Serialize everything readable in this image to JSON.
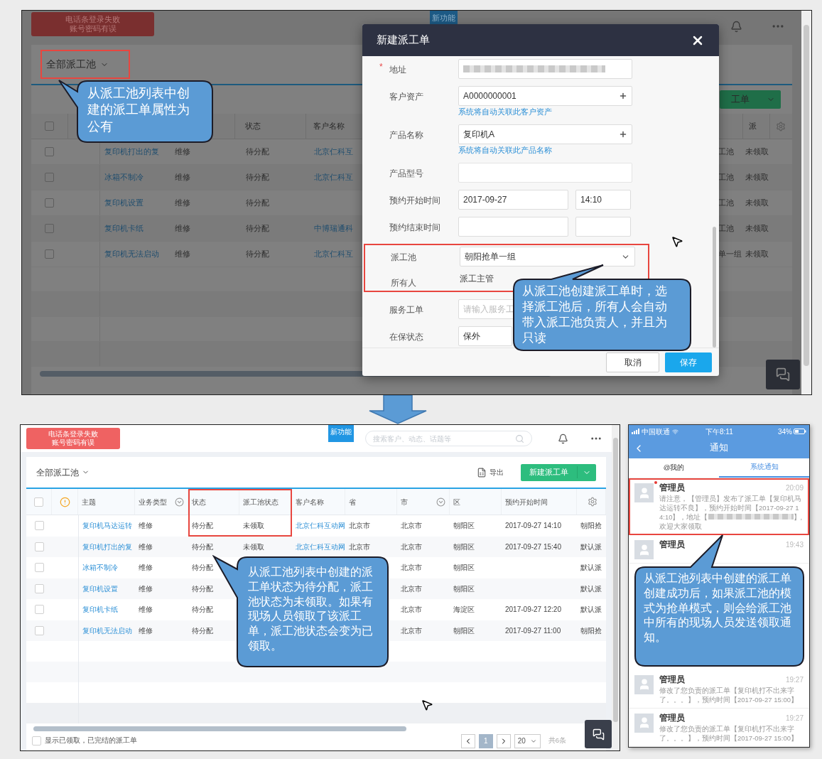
{
  "top_screen": {
    "alert": [
      "电话条登录失败",
      "账号密码有误"
    ],
    "new_feature_tag": "新功能",
    "pool_selector": {
      "label": "全部派工池",
      "highlighted": true
    },
    "create_button": "工单",
    "table": {
      "select_all_checked": false,
      "headers": {
        "status": "状态",
        "customer": "客户名称",
        "claim": "派"
      },
      "rows": [
        {
          "checked": false,
          "subject": "复印机打出的复",
          "type": "维修",
          "status": "待分配",
          "customer": "北京仁科互",
          "pool": "工池",
          "claim": "未领取"
        },
        {
          "checked": false,
          "subject": "冰箱不制冷",
          "type": "维修",
          "status": "待分配",
          "customer": "北京仁科互",
          "pool": "工池",
          "claim": "未领取"
        },
        {
          "checked": false,
          "subject": "复印机设置",
          "type": "维修",
          "status": "待分配",
          "pool": "工池",
          "claim": "未领取"
        },
        {
          "checked": false,
          "subject": "复印机卡纸",
          "type": "维修",
          "status": "待分配",
          "customer": "中博瑞通科",
          "pool": "工池",
          "claim": "未领取"
        },
        {
          "checked": false,
          "subject": "复印机无法启动",
          "type": "维修",
          "status": "待分配",
          "customer": "北京仁科互",
          "pool": "单一组",
          "claim": "未领取"
        }
      ]
    },
    "callout": "从派工池列表中创建的派工单属性为公有",
    "modal": {
      "title": "新建派工单",
      "fields": [
        {
          "kind": "redacted",
          "label": "地址",
          "required_mark": "*"
        },
        {
          "kind": "lookup",
          "label": "客户资产",
          "value": "A0000000001",
          "hint": "系统将自动关联此客户资产"
        },
        {
          "kind": "lookup",
          "label": "产品名称",
          "value": "复印机A",
          "hint": "系统将自动关联此产品名称"
        },
        {
          "kind": "disabled",
          "label": "产品型号"
        },
        {
          "kind": "datetime",
          "label": "预约开始时间",
          "date": "2017-09-27",
          "time": "14:10"
        },
        {
          "kind": "datetime",
          "label": "预约结束时间"
        },
        {
          "kind": "select",
          "label": "派工池",
          "value": "朝阳抢单一组",
          "highlighted": true
        },
        {
          "kind": "readonly",
          "label": "所有人",
          "value": "派工主管",
          "highlighted": true
        },
        {
          "kind": "input",
          "label": "服务工单",
          "placeholder": "请输入服务工"
        },
        {
          "kind": "input",
          "label": "在保状态",
          "value": "保外"
        }
      ],
      "buttons": [
        {
          "kind": "secondary",
          "label": "取消"
        },
        {
          "kind": "primary",
          "label": "保存"
        }
      ],
      "callout": "从派工池创建派工单时，选择派工池后，所有人会自动带入派工池负责人，并且为只读"
    }
  },
  "bottom_screen": {
    "alert": [
      "电话条登录失败",
      "账号密码有误"
    ],
    "new_feature_tag": "新功能",
    "search": {
      "placeholder": "搜索客户、动态、话题等"
    },
    "pool_selector": "全部派工池",
    "export": "导出",
    "create_button": "新建派工单",
    "select_all_checked": false,
    "columns": [
      {
        "kind": "checkbox"
      },
      {
        "kind": "warning"
      },
      {
        "kind": "link",
        "label": "主题"
      },
      {
        "kind": "filter",
        "label": "业务类型"
      },
      {
        "kind": "text",
        "label": "状态",
        "highlighted": true
      },
      {
        "kind": "text",
        "label": "派工池状态",
        "highlighted": true
      },
      {
        "kind": "link",
        "label": "客户名称"
      },
      {
        "kind": "text",
        "label": "省"
      },
      {
        "kind": "filter",
        "label": "市"
      },
      {
        "kind": "text",
        "label": "区"
      },
      {
        "kind": "text",
        "label": "预约开始时间"
      },
      {
        "kind": "settings"
      }
    ],
    "rows": [
      {
        "checked": false,
        "cells": [
          "",
          "",
          "复印机马达运转",
          "维修",
          "待分配",
          "未领取",
          "北京仁科互动网",
          "北京市",
          "北京市",
          "朝阳区",
          "2017-09-27 14:10",
          "朝阳抢"
        ]
      },
      {
        "checked": false,
        "cells": [
          "",
          "",
          "复印机打出的复",
          "维修",
          "待分配",
          "未领取",
          "北京仁科互动网",
          "北京市",
          "北京市",
          "朝阳区",
          "2017-09-27 15:40",
          "默认派"
        ]
      },
      {
        "checked": false,
        "cells": [
          "",
          "",
          "冰箱不制冷",
          "维修",
          "待分配",
          "",
          "",
          "",
          "北京市",
          "朝阳区",
          "",
          "默认派"
        ]
      },
      {
        "checked": false,
        "cells": [
          "",
          "",
          "复印机设置",
          "维修",
          "待分配",
          "",
          "",
          "",
          "北京市",
          "朝阳区",
          "",
          "默认派"
        ]
      },
      {
        "checked": false,
        "cells": [
          "",
          "",
          "复印机卡纸",
          "维修",
          "待分配",
          "",
          "",
          "",
          "北京市",
          "海淀区",
          "2017-09-27 12:20",
          "默认派"
        ]
      },
      {
        "checked": false,
        "cells": [
          "",
          "",
          "复印机无法启动",
          "维修",
          "待分配",
          "",
          "",
          "",
          "北京市",
          "朝阳区",
          "2017-09-27 11:00",
          "朝阳抢"
        ]
      }
    ],
    "show_done": {
      "label": "显示已领取，已完结的派工单",
      "checked": false
    },
    "pagination": {
      "pages": [
        {
          "label": "1",
          "selected": true
        }
      ],
      "page_size": "20",
      "total": "共6条"
    },
    "callout": "从派工池列表中创建的派工单状态为待分配，派工池状态为未领取。如果有现场人员领取了该派工单，派工池状态会变为已领取。"
  },
  "phone": {
    "status_bar": {
      "carrier": "中国联通",
      "time": "下午8:11",
      "battery": "34%"
    },
    "title": "通知",
    "tabs": [
      {
        "label": "@我的",
        "selected": false
      },
      {
        "label": "系统通知",
        "selected": true
      }
    ],
    "notifications": [
      {
        "sender": "管理员",
        "time": "20:09",
        "unread": true,
        "highlighted": true,
        "body": "请注意，【管理员】发布了派工单【复印机马达运转不良】，预约开始时间【2017-09-27 14:10】，地址【",
        "body_after": "】,欢迎大家领取"
      },
      {
        "sender": "管理员",
        "time": "19:43",
        "unread": false,
        "highlighted": false
      }
    ],
    "later_notifications": [
      {
        "sender": "管理员",
        "time": "19:27",
        "unread": false,
        "highlighted": false,
        "body": "修改了您负责的派工单【复印机打不出来字了。。。】，预约时间【2017-09-27 15:00】"
      },
      {
        "sender": "管理员",
        "time": "19:27",
        "unread": false,
        "highlighted": false,
        "body": "修改了您负责的派工单【复印机打不出来字了。。。】，预约时间【2017-09-27 15:00】"
      }
    ],
    "callout": "从派工池列表中创建的派工单创建成功后，如果派工池的模式为抢单模式，则会给派工池中所有的现场人员发送领取通知。"
  }
}
